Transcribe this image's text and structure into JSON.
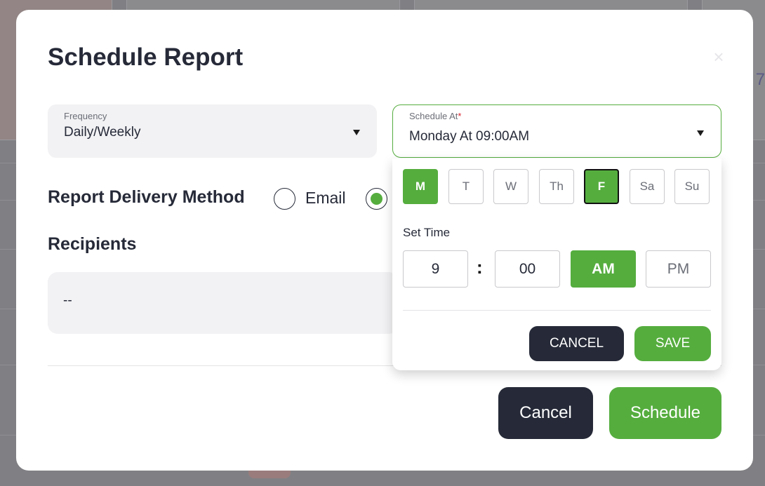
{
  "background": {
    "partial_digit": "7"
  },
  "modal": {
    "title": "Schedule Report",
    "close_glyph": "×"
  },
  "frequency": {
    "label": "Frequency",
    "value": "Daily/Weekly"
  },
  "schedule_at": {
    "label": "Schedule At",
    "required_mark": "*",
    "value": "Monday At 09:00AM"
  },
  "delivery": {
    "title": "Report Delivery Method",
    "email_label": "Email"
  },
  "recipients": {
    "title": "Recipients",
    "value": "--"
  },
  "picker": {
    "days": [
      {
        "label": "M",
        "selected": true
      },
      {
        "label": "T",
        "selected": false
      },
      {
        "label": "W",
        "selected": false
      },
      {
        "label": "Th",
        "selected": false
      },
      {
        "label": "F",
        "selected": true
      },
      {
        "label": "Sa",
        "selected": false
      },
      {
        "label": "Su",
        "selected": false
      }
    ],
    "set_time_label": "Set Time",
    "hour": "9",
    "separator": ":",
    "minute": "00",
    "am_label": "AM",
    "pm_label": "PM",
    "cancel_label": "CANCEL",
    "save_label": "SAVE"
  },
  "footer": {
    "cancel_label": "Cancel",
    "schedule_label": "Schedule"
  },
  "colors": {
    "accent": "#55ad3e",
    "dark": "#262a38",
    "required": "#d9232e"
  }
}
